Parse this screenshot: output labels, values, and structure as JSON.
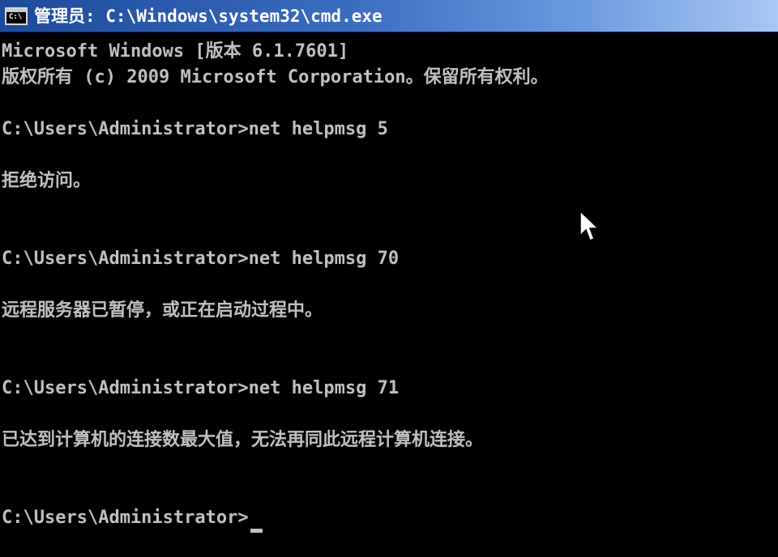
{
  "window": {
    "title": "管理员: C:\\Windows\\system32\\cmd.exe",
    "icon_label": "C:\\"
  },
  "console": {
    "lines": [
      "Microsoft Windows [版本 6.1.7601]",
      "版权所有 (c) 2009 Microsoft Corporation。保留所有权利。",
      "C:\\Users\\Administrator>net helpmsg 5",
      "拒绝访问。",
      "C:\\Users\\Administrator>net helpmsg 70",
      "远程服务器已暂停，或正在启动过程中。",
      "C:\\Users\\Administrator>net helpmsg 71",
      "已达到计算机的连接数最大值，无法再同此远程计算机连接。",
      "C:\\Users\\Administrator>"
    ]
  },
  "colors": {
    "background": "#000000",
    "text": "#c0c0c0",
    "titlebar_start": "#1c4a9a",
    "titlebar_end": "#a9c8f2"
  },
  "icons": {
    "window_icon": "cmd-icon",
    "pointer": "mouse-pointer-icon"
  }
}
